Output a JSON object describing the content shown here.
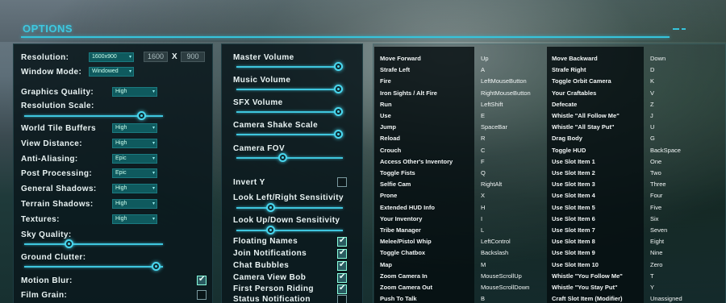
{
  "header": {
    "title": "OPTIONS"
  },
  "graphics": {
    "resolution_label": "Resolution:",
    "resolution_value": "1600x900",
    "res_width": "1600",
    "res_x": "X",
    "res_height": "900",
    "window_mode_label": "Window Mode:",
    "window_mode_value": "Windowed",
    "graphics_quality_label": "Graphics Quality:",
    "graphics_quality_value": "High",
    "resolution_scale_label": "Resolution Scale:",
    "resolution_scale_level": 0.87,
    "rows": [
      {
        "label": "World Tile Buffers",
        "value": "High"
      },
      {
        "label": "View Distance:",
        "value": "High"
      },
      {
        "label": "Anti-Aliasing:",
        "value": "Epic"
      },
      {
        "label": "Post Processing:",
        "value": "Epic"
      },
      {
        "label": "General Shadows:",
        "value": "High"
      },
      {
        "label": "Terrain Shadows:",
        "value": "High"
      },
      {
        "label": "Textures:",
        "value": "High"
      }
    ],
    "sky_quality_label": "Sky Quality:",
    "sky_quality_level": 0.33,
    "ground_clutter_label": "Ground Clutter:",
    "ground_clutter_level": 0.98,
    "motion_blur_label": "Motion Blur:",
    "motion_blur_checked": true,
    "film_grain_label": "Film Grain:",
    "film_grain_checked": false
  },
  "audio": {
    "sliders": [
      {
        "label": "Master Volume",
        "level": 1.0
      },
      {
        "label": "Music Volume",
        "level": 1.0
      },
      {
        "label": "SFX Volume",
        "level": 1.0
      },
      {
        "label": "Camera Shake Scale",
        "level": 1.0
      },
      {
        "label": "Camera FOV",
        "level": 0.45
      }
    ],
    "invert_y_label": "Invert Y",
    "invert_y_checked": false,
    "look_lr_label": "Look Left/Right Sensitivity",
    "look_lr_level": 0.33,
    "look_ud_label": "Look Up/Down Sensitivity",
    "look_ud_level": 0.33,
    "checks": [
      {
        "label": "Floating Names",
        "checked": true
      },
      {
        "label": "Join Notifications",
        "checked": true
      },
      {
        "label": "Chat Bubbles",
        "checked": true
      },
      {
        "label": "Camera View Bob",
        "checked": true
      },
      {
        "label": "First Person Riding",
        "checked": true
      },
      {
        "label": "Status Notification",
        "checked": false
      }
    ]
  },
  "keybinds_left": [
    [
      "Move Forward",
      "Up"
    ],
    [
      "Strafe Left",
      "A"
    ],
    [
      "Fire",
      "LeftMouseButton"
    ],
    [
      "Iron Sights / Alt Fire",
      "RightMouseButton"
    ],
    [
      "Run",
      "LeftShift"
    ],
    [
      "Use",
      "E"
    ],
    [
      "Jump",
      "SpaceBar"
    ],
    [
      "Reload",
      "R"
    ],
    [
      "Crouch",
      "C"
    ],
    [
      "Access Other's Inventory",
      "F"
    ],
    [
      "Toggle Fists",
      "Q"
    ],
    [
      "Selfie Cam",
      "RightAlt"
    ],
    [
      "Prone",
      "X"
    ],
    [
      "Extended HUD Info",
      "H"
    ],
    [
      "Your Inventory",
      "I"
    ],
    [
      "Tribe Manager",
      "L"
    ],
    [
      "Melee/Pistol Whip",
      "LeftControl"
    ],
    [
      "Toggle Chatbox",
      "Backslash"
    ],
    [
      "Map",
      "M"
    ],
    [
      "Zoom Camera In",
      "MouseScrollUp"
    ],
    [
      "Zoom Camera Out",
      "MouseScrollDown"
    ],
    [
      "Push To Talk",
      "B"
    ]
  ],
  "keybinds_right": [
    [
      "Move Backward",
      "Down"
    ],
    [
      "Strafe Right",
      "D"
    ],
    [
      "Toggle Orbit Camera",
      "K"
    ],
    [
      "Your Craftables",
      "V"
    ],
    [
      "Defecate",
      "Z"
    ],
    [
      "Whistle \"All Follow Me\"",
      "J"
    ],
    [
      "Whistle \"All Stay Put\"",
      "U"
    ],
    [
      "Drag Body",
      "G"
    ],
    [
      "Toggle HUD",
      "BackSpace"
    ],
    [
      "Use Slot Item 1",
      "One"
    ],
    [
      "Use Slot Item 2",
      "Two"
    ],
    [
      "Use Slot Item 3",
      "Three"
    ],
    [
      "Use Slot Item 4",
      "Four"
    ],
    [
      "Use Slot Item 5",
      "Five"
    ],
    [
      "Use Slot Item 6",
      "Six"
    ],
    [
      "Use Slot Item 7",
      "Seven"
    ],
    [
      "Use Slot Item 8",
      "Eight"
    ],
    [
      "Use Slot Item 9",
      "Nine"
    ],
    [
      "Use Slot Item 10",
      "Zero"
    ],
    [
      "Whistle \"You Follow Me\"",
      "T"
    ],
    [
      "Whistle \"You Stay Put\"",
      "Y"
    ],
    [
      "Craft Slot Item (Modifier)",
      "Unassigned"
    ]
  ]
}
